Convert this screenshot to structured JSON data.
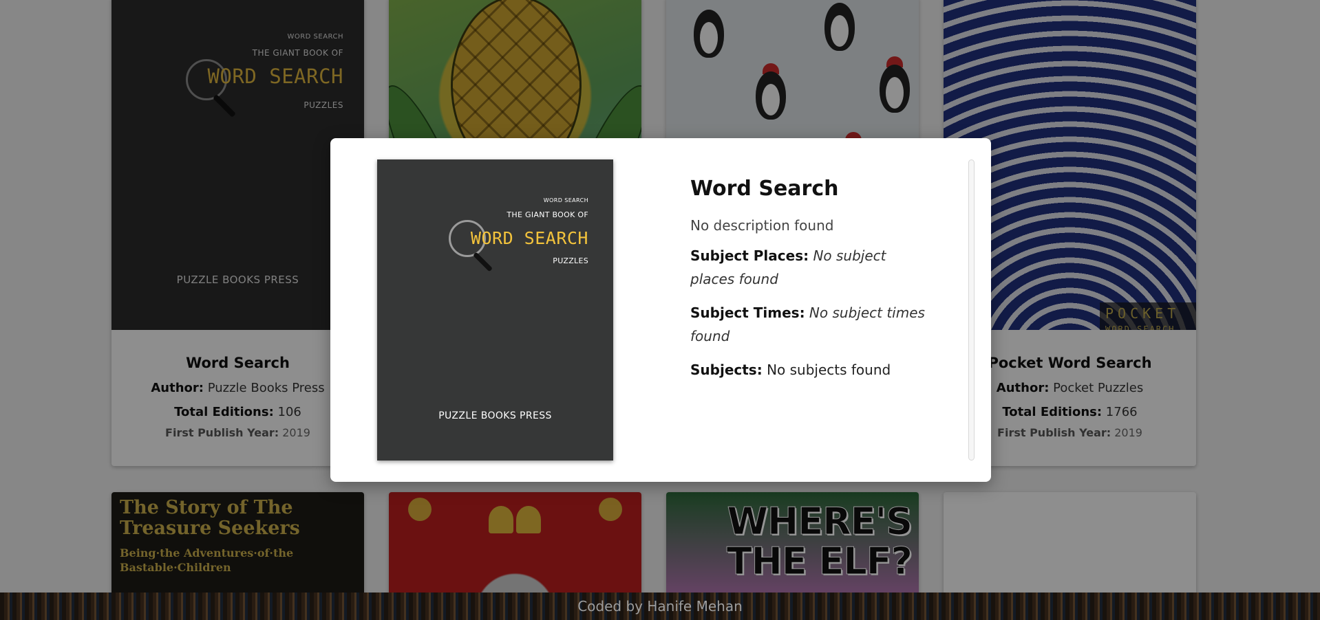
{
  "cards": [
    {
      "title": "Word Search",
      "author_label": "Author:",
      "author": "Puzzle Books Press",
      "editions_label": "Total Editions:",
      "editions": "106",
      "year_label": "First Publish Year:",
      "year": "2019",
      "cover": {
        "top_line": "WORD SEARCH",
        "sub_line": "THE GIANT BOOK OF",
        "big_line": "WORD SEARCH",
        "tag": "PUZZLES",
        "publisher": "PUZZLE BOOKS PRESS"
      }
    },
    {
      "title": "Pocket Word Search",
      "author_label": "Author:",
      "author": "Pocket Puzzles",
      "editions_label": "Total Editions:",
      "editions": "1766",
      "year_label": "First Publish Year:",
      "year": "2019",
      "cover": {
        "badge": "POCKET",
        "badge_sub": "WORD SEARCH"
      }
    }
  ],
  "bottom_covers": {
    "treasure_title": "The Story of The Treasure Seekers",
    "treasure_sub": "Being·the Adventures·of·the Bastable·Children",
    "elf_title": "WHERE'S THE ELF?"
  },
  "modal": {
    "title": "Word Search",
    "description": "No description found",
    "subject_places_label": "Subject Places:",
    "subject_places": "No subject places found",
    "subject_times_label": "Subject Times:",
    "subject_times": "No subject times found",
    "subjects_label": "Subjects:",
    "subjects": "No subjects found",
    "cover": {
      "top_line": "WORD SEARCH",
      "sub_line": "THE GIANT BOOK OF",
      "big_line": "WORD SEARCH",
      "tag": "PUZZLES",
      "publisher": "PUZZLE BOOKS PRESS"
    }
  },
  "footer": {
    "text": "Coded by Hanife Mehan"
  },
  "colors": {
    "accent_gold": "#f3c33c",
    "overlay": "#000000",
    "modal_bg": "#ffffff"
  }
}
